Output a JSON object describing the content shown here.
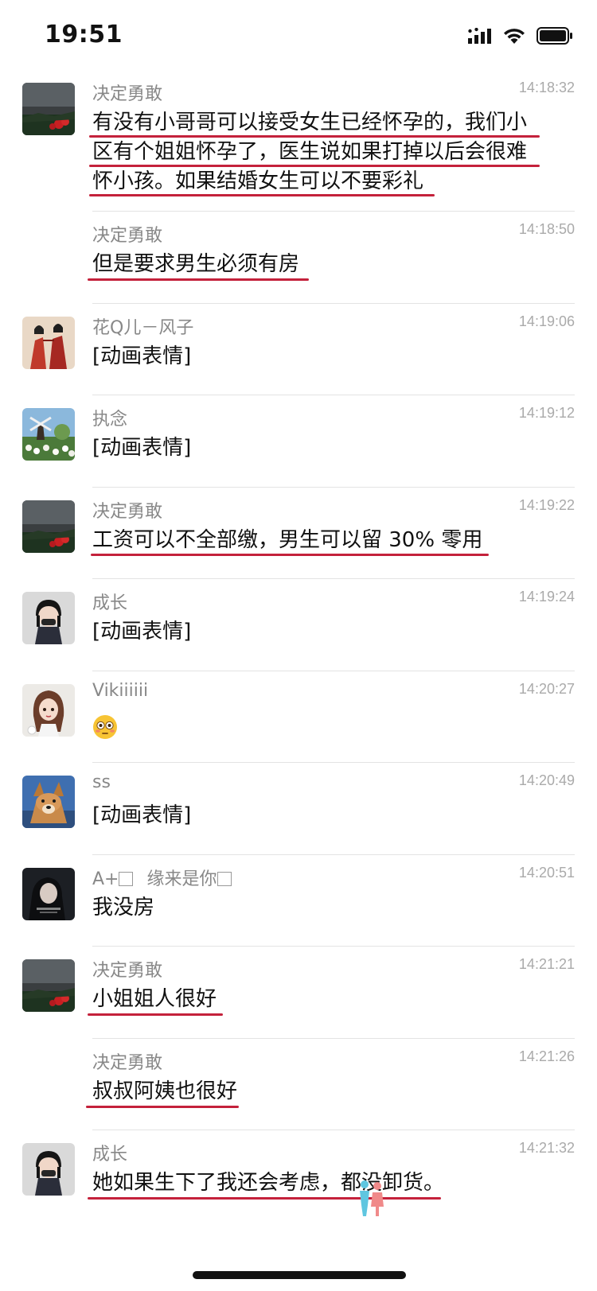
{
  "status_bar": {
    "time": "19:51",
    "icons": [
      "cellular-signal-icon",
      "wifi-icon",
      "battery-icon"
    ]
  },
  "messages": [
    {
      "sender": "决定勇敢",
      "time": "14:18:32",
      "lines": [
        "有没有小哥哥可以接受女生已经怀孕的，我们小",
        "区有个姐姐怀孕了，医生说如果打掉以后会很难",
        "怀小孩。如果结婚女生可以不要彩礼"
      ],
      "avatar": "dark-field-avatar",
      "underlined": true
    },
    {
      "sender": "决定勇敢",
      "time": "14:18:50",
      "lines": [
        "但是要求男生必须有房"
      ],
      "avatar": null,
      "underlined": true
    },
    {
      "sender": "花Q儿－风子",
      "time": "14:19:06",
      "lines": [
        "[动画表情]"
      ],
      "avatar": "red-robe-couple-avatar",
      "underlined": false
    },
    {
      "sender": "执念",
      "time": "14:19:12",
      "lines": [
        "[动画表情]"
      ],
      "avatar": "windmill-garden-avatar",
      "underlined": false
    },
    {
      "sender": "决定勇敢",
      "time": "14:19:22",
      "lines": [
        "工资可以不全部缴，男生可以留 30% 零用"
      ],
      "avatar": "dark-field-avatar",
      "underlined": true
    },
    {
      "sender": "成长",
      "time": "14:19:24",
      "lines": [
        "[动画表情]"
      ],
      "avatar": "girl-portrait-avatar",
      "underlined": false
    },
    {
      "sender": "Vikiiiiii",
      "time": "14:20:27",
      "lines": [
        ""
      ],
      "emoji": "flushed-face-emoji",
      "avatar": "cartoon-girl-avatar",
      "underlined": false
    },
    {
      "sender": "ss",
      "time": "14:20:49",
      "lines": [
        "[动画表情]"
      ],
      "avatar": "dog-avatar",
      "underlined": false
    },
    {
      "sender": "A+",
      "sender_suffix": "缘来是你",
      "time": "14:20:51",
      "lines": [
        "我没房"
      ],
      "avatar": "dark-portrait-avatar",
      "underlined": false
    },
    {
      "sender": "决定勇敢",
      "time": "14:21:21",
      "lines": [
        "小姐姐人很好"
      ],
      "avatar": "dark-field-avatar",
      "underlined": true
    },
    {
      "sender": "决定勇敢",
      "time": "14:21:26",
      "lines": [
        "叔叔阿姨也很好"
      ],
      "avatar": null,
      "underlined": true
    },
    {
      "sender": "成长",
      "time": "14:21:32",
      "lines": [
        "她如果生下了我还会考虑，都没卸货。"
      ],
      "avatar": "girl-portrait-avatar",
      "underlined": true
    }
  ],
  "colors": {
    "underline": "#c4213b",
    "sender": "#888888",
    "time": "#aaaaaa",
    "text": "#111111",
    "divider": "#e3e3e3"
  }
}
